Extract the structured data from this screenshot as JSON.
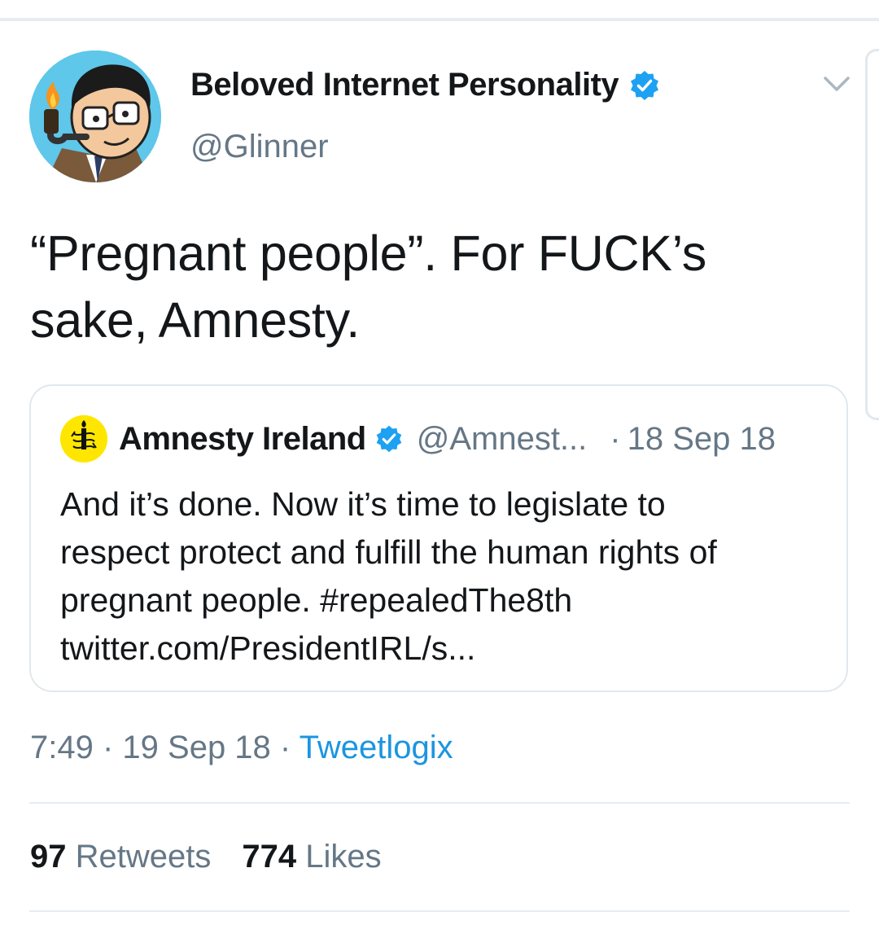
{
  "tweet": {
    "author": {
      "display_name": "Beloved Internet Personality",
      "handle": "@Glinner",
      "verified": true,
      "avatar_icon": "cartoon-pipe-avatar"
    },
    "text_line1": "“Pregnant people”. For FUCK’s",
    "text_line2": "sake, Amnesty.",
    "quoted": {
      "display_name": "Amnesty Ireland",
      "handle": "@Amnest...",
      "separator": "·",
      "date": "18 Sep 18",
      "verified": true,
      "avatar_icon": "amnesty-candle-logo",
      "text_lines": [
        "And it’s done. Now it’s time to legislate to",
        "respect protect and fulfill the human rights of",
        "pregnant people. #repealedThe8th",
        "twitter.com/PresidentIRL/s..."
      ]
    },
    "meta": {
      "time": "7:49",
      "sep1": " · ",
      "date": "19 Sep 18",
      "sep2": " · ",
      "source": "Tweetlogix"
    },
    "stats": {
      "retweets_count": "97",
      "retweets_label": "Retweets",
      "likes_count": "774",
      "likes_label": "Likes"
    }
  },
  "colors": {
    "verified_blue": "#1da1f2",
    "secondary_text": "#657786",
    "link_blue": "#1b95e0",
    "amnesty_yellow": "#ffe600"
  }
}
